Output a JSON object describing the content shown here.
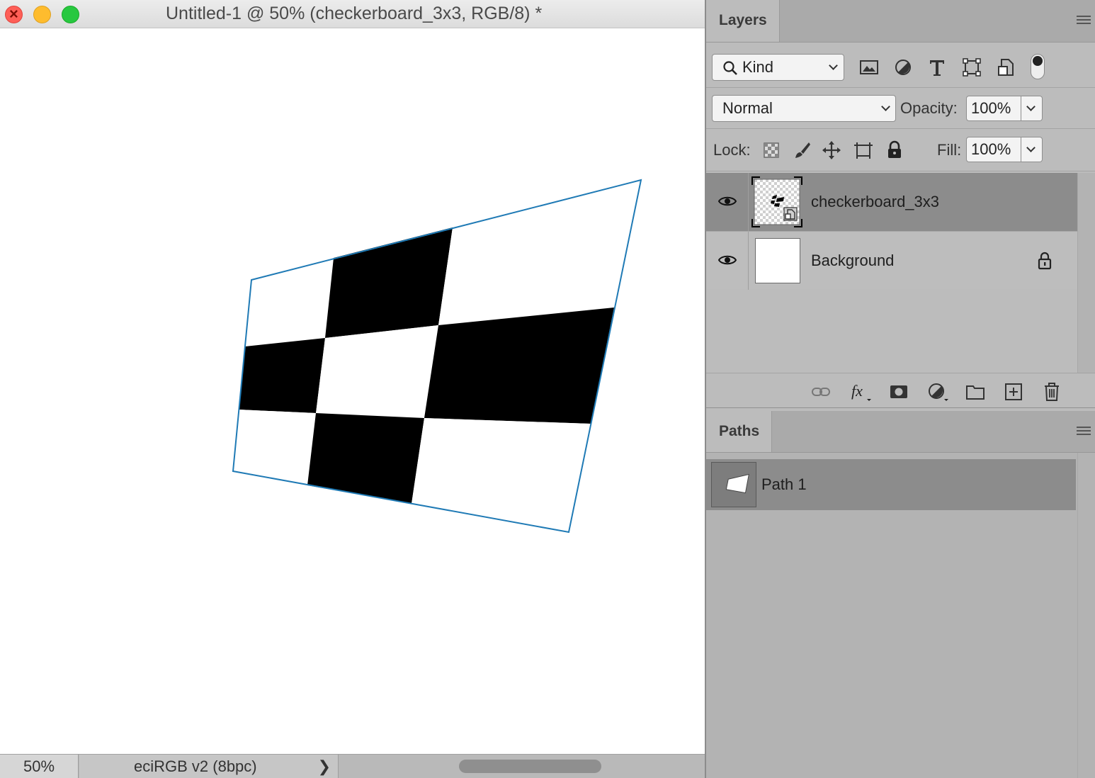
{
  "document": {
    "title": "Untitled-1 @ 50% (checkerboard_3x3, RGB/8) *",
    "zoom": "50%",
    "color_profile": "eciRGB v2 (8bpc)",
    "profile_arrow": "❯"
  },
  "layers_panel": {
    "tab_label": "Layers",
    "filter": {
      "kind_label": "Kind"
    },
    "blend_mode": "Normal",
    "opacity_label": "Opacity:",
    "opacity_value": "100%",
    "lock_label": "Lock:",
    "fill_label": "Fill:",
    "fill_value": "100%",
    "layers": [
      {
        "name": "checkerboard_3x3",
        "visible": true,
        "selected": true,
        "type": "smart-object"
      },
      {
        "name": "Background",
        "visible": true,
        "selected": false,
        "locked": true
      }
    ]
  },
  "paths_panel": {
    "tab_label": "Paths",
    "paths": [
      {
        "name": "Path 1",
        "selected": true
      }
    ]
  },
  "colors": {
    "path_stroke": "#1f7ab5",
    "panel_bg": "#bcbcbc",
    "selected_row": "#8c8c8c"
  }
}
